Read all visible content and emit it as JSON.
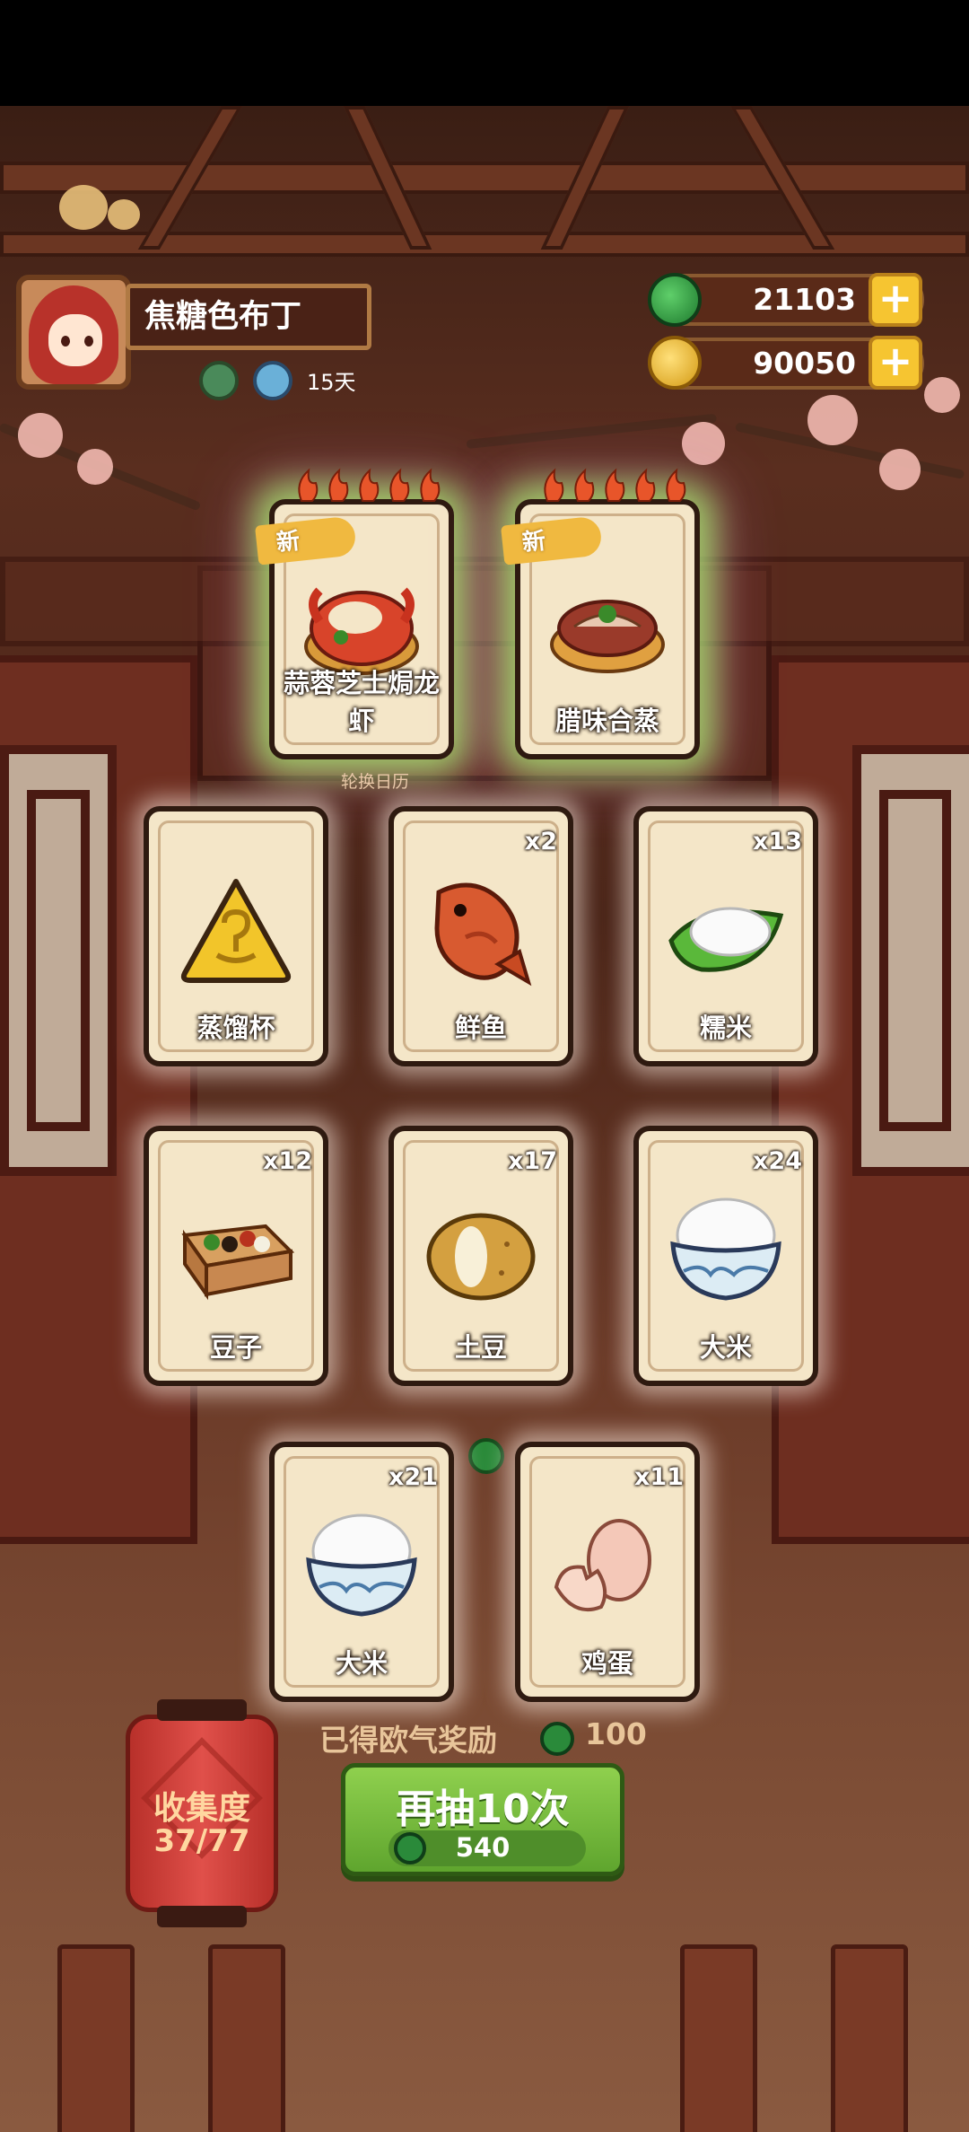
{
  "player": {
    "name": "焦糖色布丁",
    "days": "15天"
  },
  "currency": {
    "jade": {
      "amount": "21103",
      "icon": "jade-coin-icon"
    },
    "gold": {
      "amount": "90050",
      "icon": "gold-coin-icon"
    }
  },
  "featured": [
    {
      "tag": "新",
      "label": "蒜蓉芝士焗龙虾"
    },
    {
      "tag": "新",
      "label": "腊味合蒸"
    }
  ],
  "rotate_label": "轮换日历",
  "items": [
    {
      "label": "蒸馏杯",
      "qty": ""
    },
    {
      "label": "鲜鱼",
      "qty": "x2"
    },
    {
      "label": "糯米",
      "qty": "x13"
    },
    {
      "label": "豆子",
      "qty": "x12"
    },
    {
      "label": "土豆",
      "qty": "x17"
    },
    {
      "label": "大米",
      "qty": "x24"
    },
    {
      "label": "大米",
      "qty": "x21"
    },
    {
      "label": "鸡蛋",
      "qty": "x11"
    }
  ],
  "collection": {
    "title": "收集度",
    "progress": "37/77"
  },
  "reward": {
    "text": "已得欧气奖励",
    "amount": "100"
  },
  "draw": {
    "label": "再抽10次",
    "cost": "540"
  },
  "colors": {
    "jade": "#2a8a3a",
    "gold": "#f6c531",
    "button_green": "#6fb83a",
    "lantern_red": "#d0403a"
  }
}
